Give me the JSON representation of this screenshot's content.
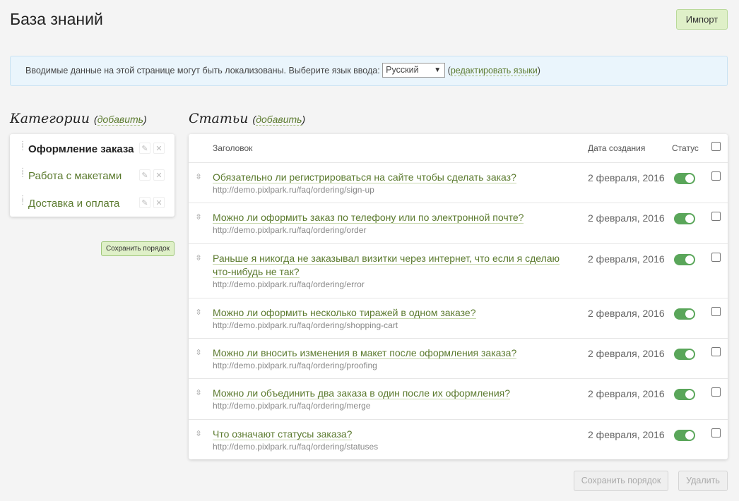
{
  "header": {
    "title": "База знаний",
    "import_label": "Импорт"
  },
  "notice": {
    "text": "Вводимые данные на этой странице могут быть локализованы. Выберите язык ввода:",
    "language": "Русский",
    "edit_languages": "редактировать языки"
  },
  "categories": {
    "title": "Категории",
    "add_label": "добавить",
    "items": [
      {
        "label": "Оформление заказа",
        "active": true
      },
      {
        "label": "Работа с макетами",
        "active": false
      },
      {
        "label": "Доставка и оплата",
        "active": false
      }
    ],
    "save_order_label": "Сохранить порядок"
  },
  "articles": {
    "title": "Статьи",
    "add_label": "добавить",
    "columns": {
      "title": "Заголовок",
      "date": "Дата создания",
      "status": "Статус"
    },
    "rows": [
      {
        "title": "Обязательно ли регистрироваться на сайте чтобы сделать заказ?",
        "url": "http://demo.pixlpark.ru/faq/ordering/sign-up",
        "date": "2 февраля, 2016",
        "status": true
      },
      {
        "title": "Можно ли оформить заказ по телефону или по электронной почте?",
        "url": "http://demo.pixlpark.ru/faq/ordering/order",
        "date": "2 февраля, 2016",
        "status": true
      },
      {
        "title": "Раньше я никогда не заказывал визитки через интернет, что если я сделаю что-нибудь не так?",
        "url": "http://demo.pixlpark.ru/faq/ordering/error",
        "date": "2 февраля, 2016",
        "status": true
      },
      {
        "title": "Можно ли оформить несколько тиражей в одном заказе?",
        "url": "http://demo.pixlpark.ru/faq/ordering/shopping-cart",
        "date": "2 февраля, 2016",
        "status": true
      },
      {
        "title": "Можно ли вносить изменения в макет после оформления заказа?",
        "url": "http://demo.pixlpark.ru/faq/ordering/proofing",
        "date": "2 февраля, 2016",
        "status": true
      },
      {
        "title": "Можно ли объединить два заказа в один после их оформления?",
        "url": "http://demo.pixlpark.ru/faq/ordering/merge",
        "date": "2 февраля, 2016",
        "status": true
      },
      {
        "title": "Что означают статусы заказа?",
        "url": "http://demo.pixlpark.ru/faq/ordering/statuses",
        "date": "2 февраля, 2016",
        "status": true
      }
    ],
    "save_order_label": "Сохранить порядок",
    "delete_label": "Удалить"
  },
  "colors": {
    "accent_green": "#5b7a2e",
    "toggle_on": "#5aa65a",
    "notice_bg": "#eaf5fc",
    "import_bg": "#dff0c8"
  }
}
